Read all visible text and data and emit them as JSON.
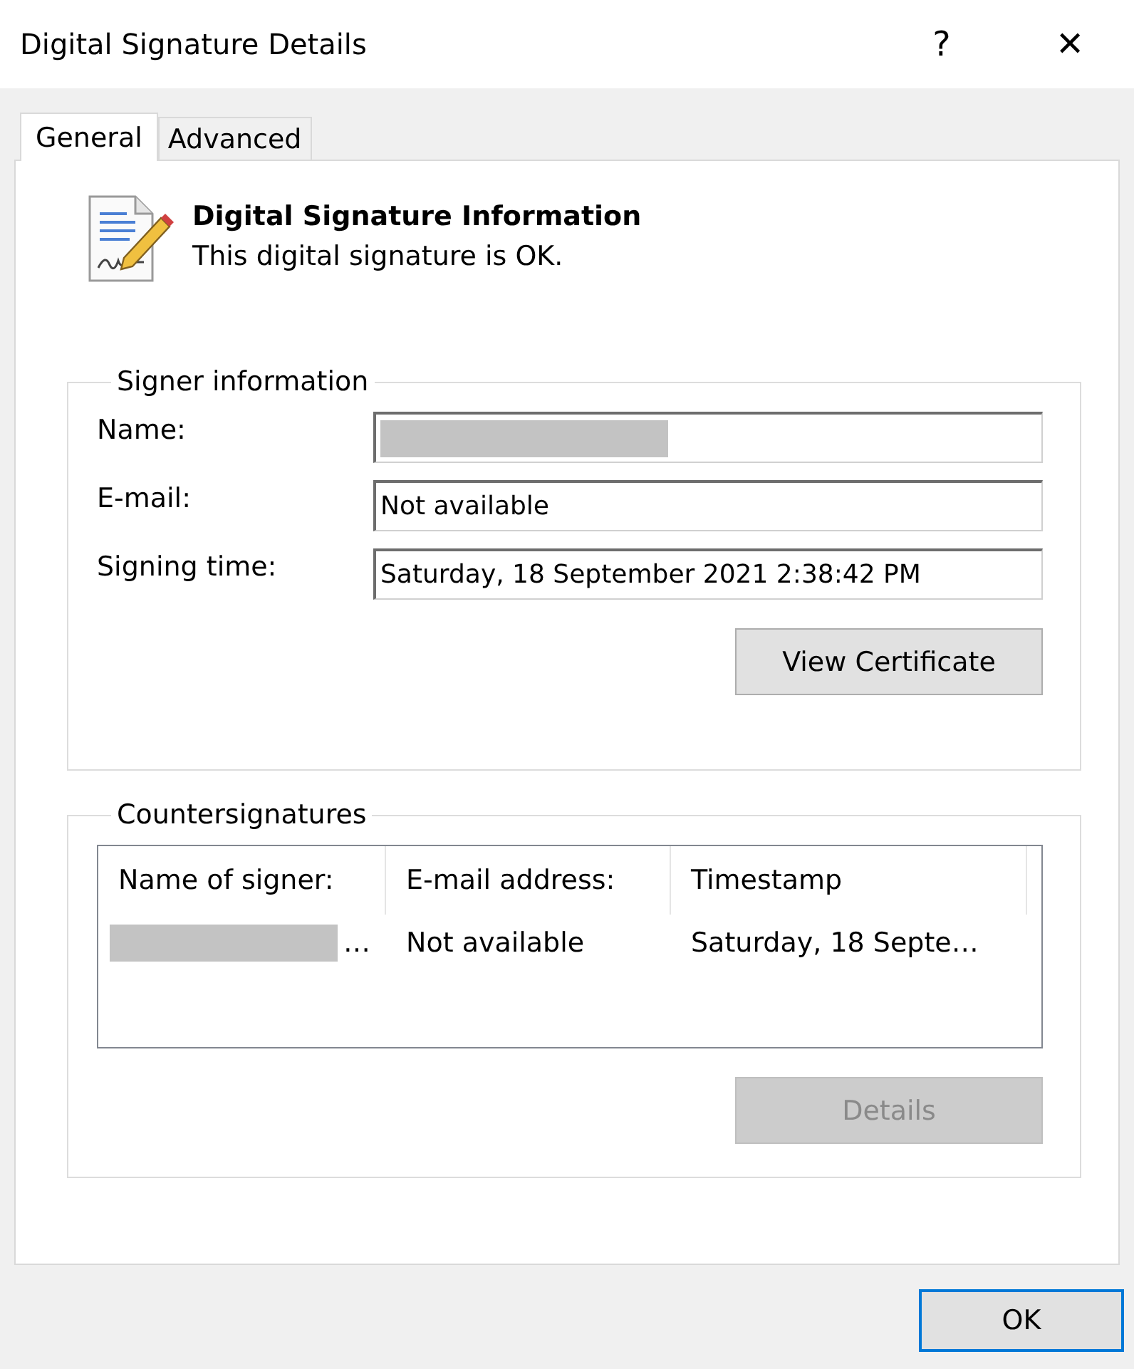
{
  "window": {
    "title": "Digital Signature Details",
    "help_glyph": "?",
    "close_glyph": "✕"
  },
  "tabs": [
    {
      "label": "General",
      "selected": true
    },
    {
      "label": "Advanced",
      "selected": false
    }
  ],
  "header": {
    "title": "Digital Signature Information",
    "status": "This digital signature is OK."
  },
  "signer_information": {
    "title": "Signer information",
    "fields": [
      {
        "label": "Name:",
        "redacted": true
      },
      {
        "label": "E-mail:",
        "value": "Not available",
        "redacted": false
      },
      {
        "label": "Signing time:",
        "value": "Saturday, 18 September 2021 2:38:42 PM",
        "redacted": false
      }
    ],
    "button": {
      "label": "View Certificate",
      "disabled": false
    }
  },
  "countersignatures": {
    "title": "Countersignatures",
    "columns": [
      "Name of signer:",
      "E-mail address:",
      "Timestamp"
    ],
    "rows": [
      [
        {
          "text": "…",
          "redacted": true
        },
        {
          "text": "Not available",
          "redacted": false
        },
        {
          "text": "Saturday, 18 Septe…",
          "redacted": false
        }
      ]
    ],
    "button": {
      "label": "Details",
      "disabled": true
    }
  },
  "footer": {
    "button": {
      "label": "OK",
      "default": true
    }
  }
}
